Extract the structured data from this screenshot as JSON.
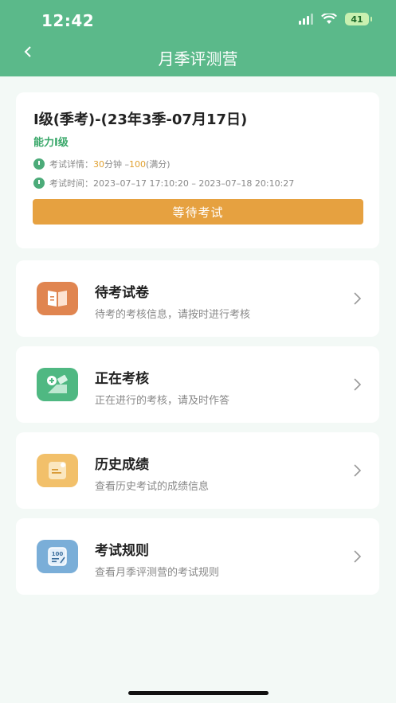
{
  "status_bar": {
    "time": "12:42",
    "battery": "41"
  },
  "header": {
    "title": "月季评测营"
  },
  "exam": {
    "title": "I级(季考)-(23年3季-07月17日)",
    "level": "能力I级",
    "detail_label": "考试详情：",
    "duration": "30",
    "duration_unit": "分钟",
    "sep": " –",
    "full_score": "100",
    "full_score_unit": "(满分)",
    "time_label": "考试时间：",
    "time_range": "2023–07–17 17:10:20 – 2023–07–18 20:10:27",
    "button": "等待考试"
  },
  "menu": [
    {
      "title": "待考试卷",
      "subtitle": "待考的考核信息，请按时进行考核",
      "icon": "book-icon",
      "color": "#e08550"
    },
    {
      "title": "正在考核",
      "subtitle": "正在进行的考核，请及时作答",
      "icon": "exam-tools-icon",
      "color": "#4fb882"
    },
    {
      "title": "历史成绩",
      "subtitle": "查看历史考试的成绩信息",
      "icon": "score-sheet-icon",
      "color": "#f2c06a"
    },
    {
      "title": "考试规则",
      "subtitle": "查看月季评测营的考试规则",
      "icon": "rules-icon",
      "color": "#7aaed8"
    }
  ]
}
